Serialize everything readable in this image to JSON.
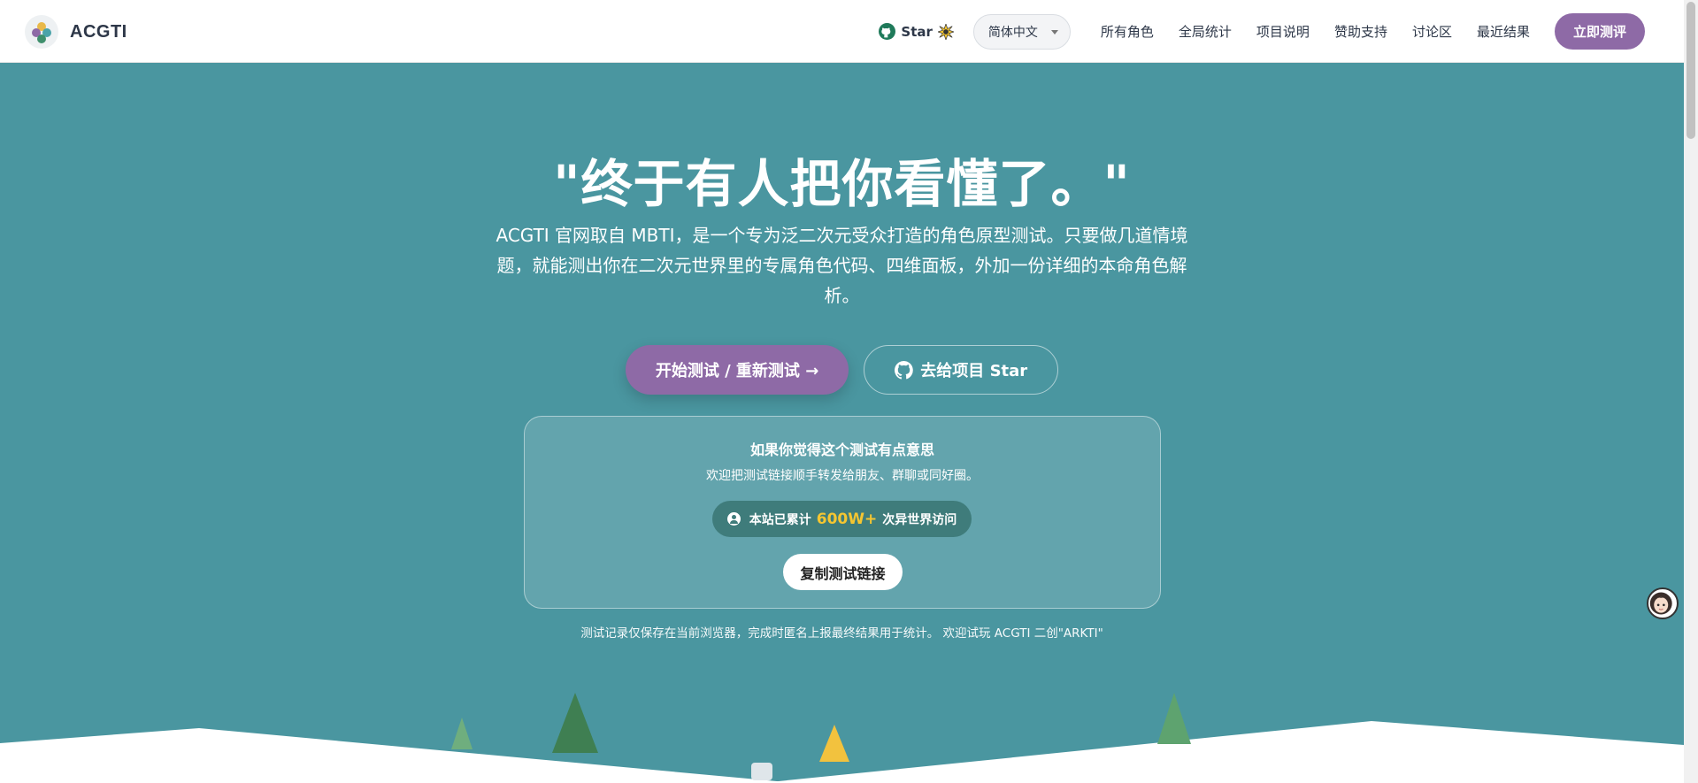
{
  "header": {
    "brand": "ACGTI",
    "github_star": "Star",
    "language": "简体中文",
    "nav": [
      "所有角色",
      "全局统计",
      "项目说明",
      "赞助支持",
      "讨论区",
      "最近结果"
    ],
    "cta": "立即测评"
  },
  "hero": {
    "headline": "\"终于有人把你看懂了。\"",
    "intro": "ACGTI 官网取自 MBTI，是一个专为泛二次元受众打造的角色原型测试。只要做几道情境题，就能测出你在二次元世界里的专属角色代码、四维面板，外加一份详细的本命角色解析。",
    "primary_button": "开始测试 / 重新测试 →",
    "secondary_button": "去给项目 Star"
  },
  "share": {
    "title": "如果你觉得这个测试有点意思",
    "subtitle": "欢迎把测试链接顺手转发给朋友、群聊或同好圈。",
    "visit_prefix": "本站已累计",
    "visit_count": "600W+",
    "visit_suffix": "次异世界访问",
    "copy_button": "复制测试链接"
  },
  "footnote": {
    "text": "测试记录仅保存在当前浏览器，完成时匿名上报最终结果用于统计。",
    "link": "欢迎试玩 ACGTI 二创\"ARKTI\""
  },
  "colors": {
    "hero_bg": "#4a96a0",
    "accent_purple": "#8e6aa6",
    "visit_highlight": "#f5c631"
  }
}
